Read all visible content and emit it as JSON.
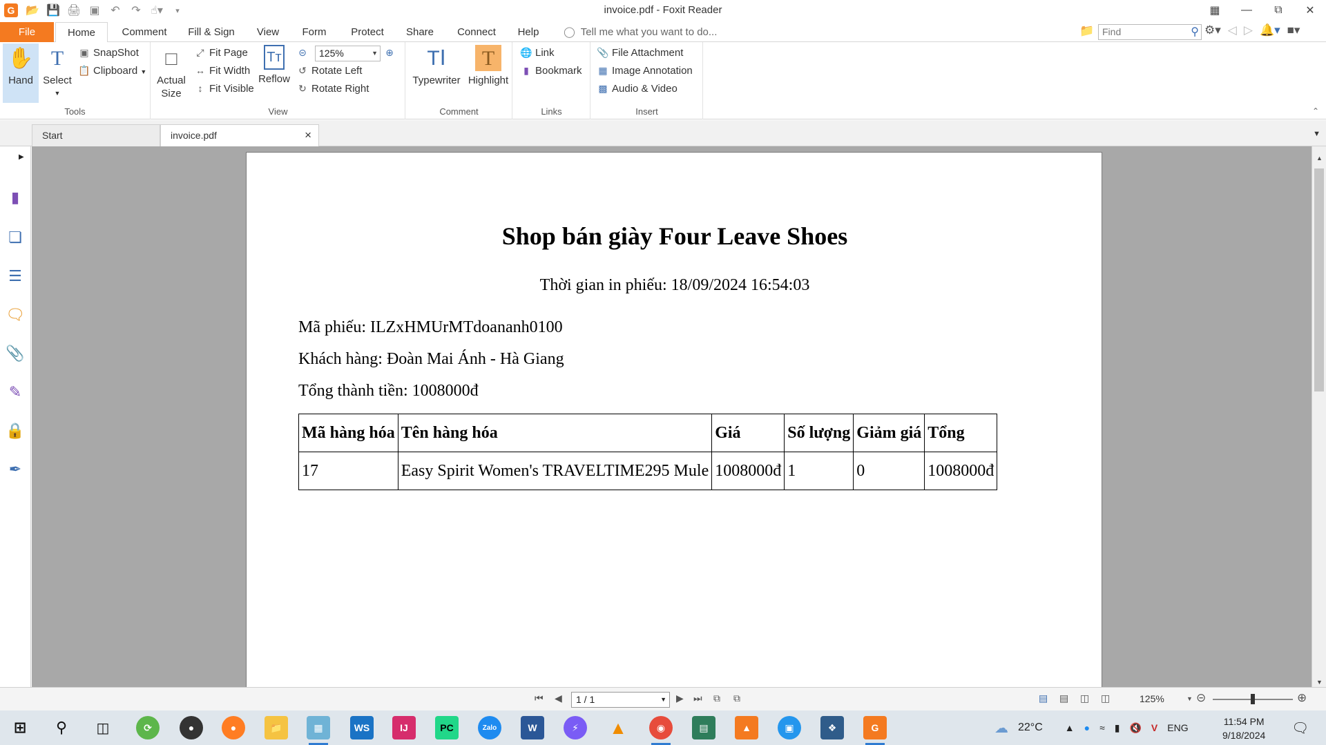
{
  "window": {
    "title": "invoice.pdf - Foxit Reader"
  },
  "menu": {
    "file": "File",
    "tabs": [
      "Home",
      "Comment",
      "Fill & Sign",
      "View",
      "Form",
      "Protect",
      "Share",
      "Connect",
      "Help"
    ],
    "tell_me_placeholder": "Tell me what you want to do...",
    "find_placeholder": "Find"
  },
  "ribbon": {
    "tools": {
      "label": "Tools",
      "hand": "Hand",
      "select": "Select",
      "snapshot": "SnapShot",
      "clipboard": "Clipboard"
    },
    "view": {
      "label": "View",
      "actual_size_line1": "Actual",
      "actual_size_line2": "Size",
      "fit_page": "Fit Page",
      "fit_width": "Fit Width",
      "fit_visible": "Fit Visible",
      "reflow": "Reflow",
      "zoom_value": "125%",
      "rotate_left": "Rotate Left",
      "rotate_right": "Rotate Right"
    },
    "comment": {
      "label": "Comment",
      "typewriter": "Typewriter",
      "highlight": "Highlight"
    },
    "links": {
      "label": "Links",
      "link": "Link",
      "bookmark": "Bookmark"
    },
    "insert": {
      "label": "Insert",
      "file_attachment": "File Attachment",
      "image_annotation": "Image Annotation",
      "audio_video": "Audio & Video"
    }
  },
  "doc_tabs": {
    "start": "Start",
    "current": "invoice.pdf"
  },
  "document": {
    "title": "Shop bán giày Four Leave Shoes",
    "print_time": "Thời gian in phiếu: 18/09/2024 16:54:03",
    "receipt_code": "Mã phiếu: ILZxHMUrMTdoananh0100",
    "customer": "Khách hàng: Đoàn Mai Ánh - Hà Giang",
    "total": "Tổng thành tiền: 1008000đ",
    "table": {
      "headers": [
        "Mã hàng hóa",
        "Tên hàng hóa",
        "Giá",
        "Số lượng",
        "Giảm giá",
        "Tổng"
      ],
      "rows": [
        [
          "17",
          "Easy Spirit Women's TRAVELTIME295 Mule",
          "1008000đ",
          "1",
          "0",
          "1008000đ"
        ]
      ]
    }
  },
  "statusbar": {
    "page_value": "1 / 1",
    "zoom": "125%",
    "zoom_fraction": 0.5
  },
  "taskbar": {
    "weather": "22°C",
    "language": "ENG",
    "time": "11:54 PM",
    "date": "9/18/2024",
    "apps": [
      "start",
      "search",
      "task-view",
      "app-green",
      "obs",
      "firefox",
      "file-explorer",
      "app-blue",
      "webstorm",
      "intellij",
      "pycharm",
      "zalo",
      "word",
      "messenger",
      "vlc",
      "chrome",
      "app-terminal",
      "app-orange",
      "docker",
      "mysql-workbench",
      "foxit-reader"
    ]
  },
  "colors": {
    "accent": "#f47a20",
    "ribbon_icon": "#3e6fb0",
    "doc_background": "#a8a8a8",
    "taskbar": "#dfe6ec"
  }
}
